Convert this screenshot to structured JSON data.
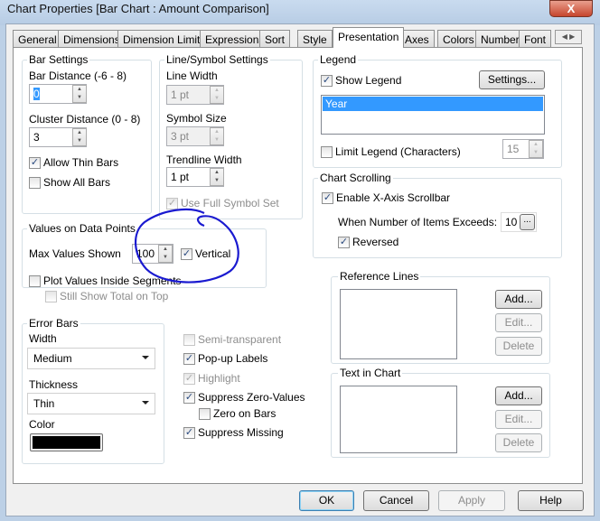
{
  "window": {
    "title": "Chart Properties [Bar Chart : Amount Comparison]",
    "close": "X"
  },
  "tabs": [
    "General",
    "Dimensions",
    "Dimension Limits",
    "Expressions",
    "Sort",
    "Style",
    "Presentation",
    "Axes",
    "Colors",
    "Number",
    "Font"
  ],
  "active_tab": "Presentation",
  "bar_settings": {
    "title": "Bar Settings",
    "bar_distance_label": "Bar Distance (-6 - 8)",
    "bar_distance": "0",
    "cluster_distance_label": "Cluster Distance (0 - 8)",
    "cluster_distance": "3",
    "allow_thin_bars": "Allow Thin Bars",
    "allow_thin_bars_checked": true,
    "show_all_bars": "Show All Bars",
    "show_all_bars_checked": false
  },
  "line_symbol": {
    "title": "Line/Symbol Settings",
    "line_width_label": "Line Width",
    "line_width": "1 pt",
    "symbol_size_label": "Symbol Size",
    "symbol_size": "3 pt",
    "trendline_width_label": "Trendline Width",
    "trendline_width": "1 pt",
    "use_full_symbol_set": "Use Full Symbol Set"
  },
  "values_on_points": {
    "title": "Values on Data Points",
    "max_values_label": "Max Values Shown",
    "max_values": "100",
    "vertical": "Vertical",
    "vertical_checked": true,
    "plot_inside": "Plot Values Inside Segments",
    "still_show_total": "Still Show Total on Top"
  },
  "annotation": {
    "color": "#1a1ad0"
  },
  "error_bars": {
    "title": "Error Bars",
    "width_label": "Width",
    "width": "Medium",
    "thickness_label": "Thickness",
    "thickness": "Thin",
    "color_label": "Color",
    "color": "#000000"
  },
  "options": {
    "semi_transparent": "Semi-transparent",
    "popup_labels": "Pop-up Labels",
    "highlight": "Highlight",
    "suppress_zero": "Suppress Zero-Values",
    "zero_on_bars": "Zero on Bars",
    "suppress_missing": "Suppress Missing"
  },
  "legend": {
    "title": "Legend",
    "show_legend": "Show Legend",
    "settings": "Settings...",
    "items": [
      "Year"
    ],
    "limit_legend": "Limit Legend (Characters)",
    "limit_value": "15"
  },
  "chart_scrolling": {
    "title": "Chart Scrolling",
    "enable": "Enable X-Axis Scrollbar",
    "items_exceeds_label": "When Number of Items Exceeds:",
    "items_exceeds": "10",
    "browse": "...",
    "reversed": "Reversed"
  },
  "reference_lines": {
    "title": "Reference Lines",
    "add": "Add...",
    "edit": "Edit...",
    "delete": "Delete"
  },
  "text_in_chart": {
    "title": "Text in Chart",
    "add": "Add...",
    "edit": "Edit...",
    "delete": "Delete"
  },
  "footer": {
    "ok": "OK",
    "cancel": "Cancel",
    "apply": "Apply",
    "help": "Help"
  }
}
